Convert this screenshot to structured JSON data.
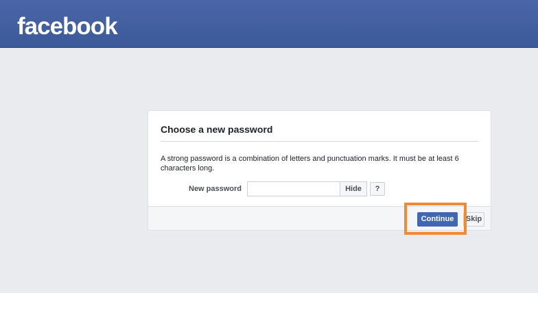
{
  "header": {
    "logo_text": "facebook"
  },
  "card": {
    "title": "Choose a new password",
    "description": "A strong password is a combination of letters and punctuation marks. It must be at least 6 characters long.",
    "password_label": "New password",
    "password_value": "",
    "hide_label": "Hide",
    "help_label": "?"
  },
  "footer": {
    "continue_label": "Continue",
    "skip_label": "Skip"
  },
  "colors": {
    "brand_blue": "#3b5998",
    "button_blue": "#4267b2",
    "highlight_orange": "#f08a33",
    "page_background": "#e9ebee"
  }
}
